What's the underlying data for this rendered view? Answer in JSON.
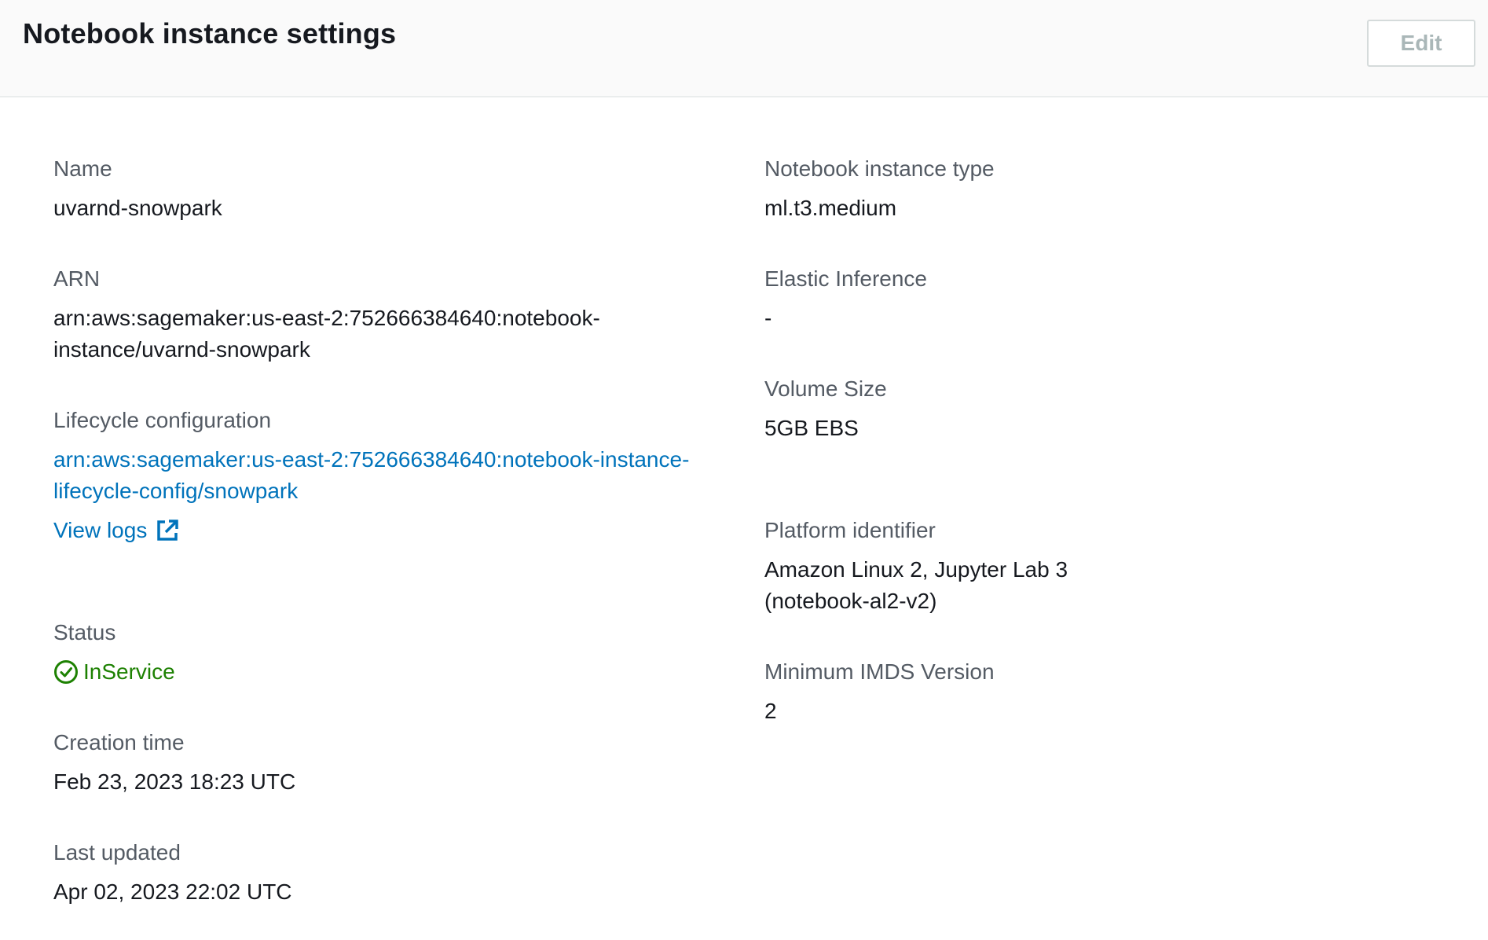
{
  "header": {
    "title": "Notebook instance settings",
    "edit_label": "Edit"
  },
  "left": {
    "name": {
      "label": "Name",
      "value": "uvarnd-snowpark"
    },
    "arn": {
      "label": "ARN",
      "line1": "arn:aws:sagemaker:us-east-2:752666384640:notebook-",
      "line2": "instance/uvarnd-snowpark"
    },
    "lifecycle": {
      "label": "Lifecycle configuration",
      "line1": "arn:aws:sagemaker:us-east-2:752666384640:notebook-instance-",
      "line2": "lifecycle-config/snowpark",
      "view_logs": "View logs"
    },
    "status": {
      "label": "Status",
      "value": "InService",
      "color": "#1d8102"
    },
    "creation": {
      "label": "Creation time",
      "value": "Feb 23, 2023 18:23 UTC"
    },
    "updated": {
      "label": "Last updated",
      "value": "Apr 02, 2023 22:02 UTC"
    }
  },
  "right": {
    "instance_type": {
      "label": "Notebook instance type",
      "value": "ml.t3.medium"
    },
    "elastic_inference": {
      "label": "Elastic Inference",
      "value": "-"
    },
    "volume_size": {
      "label": "Volume Size",
      "value": "5GB EBS"
    },
    "platform": {
      "label": "Platform identifier",
      "line1": "Amazon Linux 2, Jupyter Lab 3",
      "line2": "(notebook-al2-v2)"
    },
    "imds": {
      "label": "Minimum IMDS Version",
      "value": "2"
    }
  },
  "colors": {
    "link": "#0073bb",
    "label": "#545b64",
    "text": "#16191f",
    "success": "#1d8102"
  }
}
